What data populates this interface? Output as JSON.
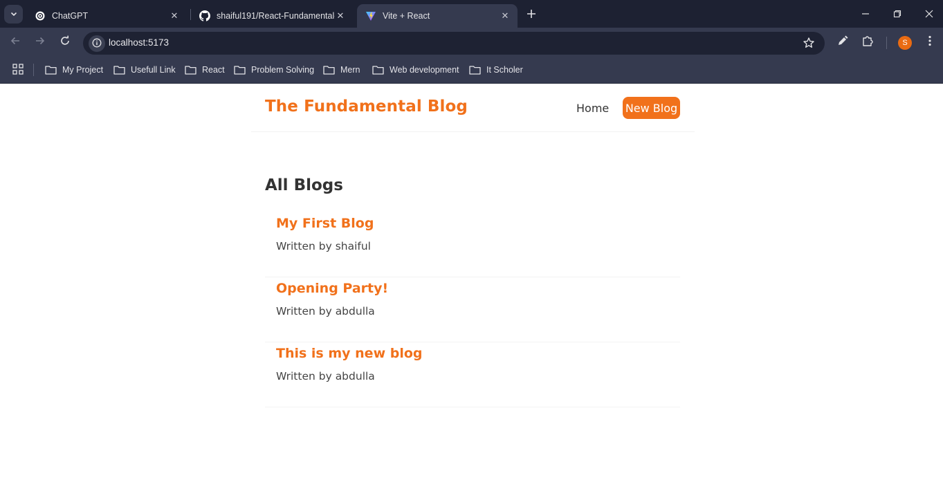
{
  "browser": {
    "tabs": [
      {
        "title": "ChatGPT",
        "icon": "chatgpt-icon"
      },
      {
        "title": "shaiful191/React-Fundamental-",
        "icon": "github-icon"
      },
      {
        "title": "Vite + React",
        "icon": "vite-icon"
      }
    ],
    "url": "localhost:5173",
    "profile_initial": "S",
    "bookmarks": [
      "My Project",
      "Usefull Link",
      "React",
      "Problem Solving",
      "Mern",
      "Web development",
      "It Scholer"
    ]
  },
  "navbar": {
    "brand": "The Fundamental Blog",
    "links": {
      "home": "Home",
      "new_blog": "New Blog"
    }
  },
  "main": {
    "heading": "All Blogs",
    "blogs": [
      {
        "title": "My First Blog",
        "author_line": "Written by shaiful"
      },
      {
        "title": "Opening Party!",
        "author_line": "Written by abdulla"
      },
      {
        "title": "This is my new blog",
        "author_line": "Written by abdulla"
      }
    ]
  },
  "colors": {
    "accent": "#f1711b",
    "chrome_dark": "#1d2132",
    "chrome": "#353a4f"
  }
}
